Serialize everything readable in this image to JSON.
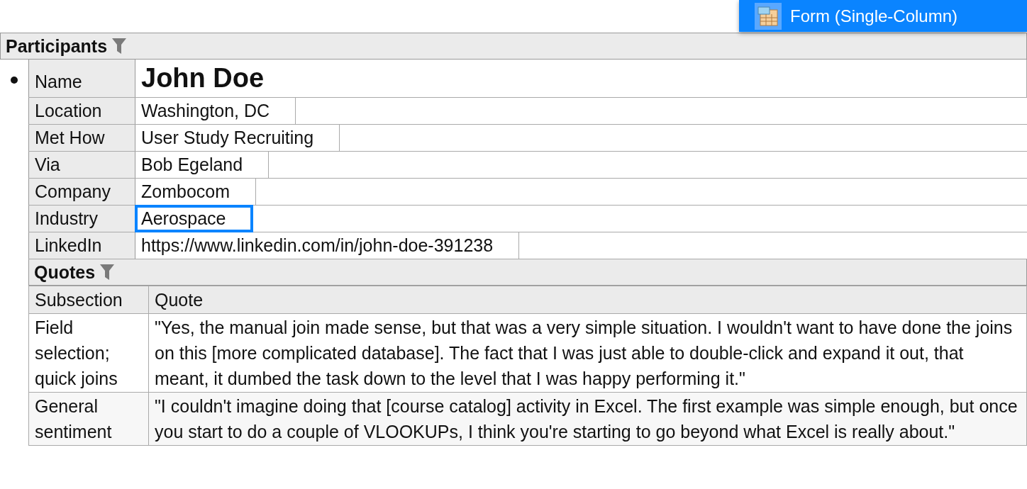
{
  "popup": {
    "label": "Form (Single-Column)"
  },
  "participants": {
    "title": "Participants",
    "records": [
      {
        "fields": [
          {
            "kind": "name",
            "label": "Name",
            "value": "John Doe",
            "selected": false
          },
          {
            "kind": "text",
            "label": "Location",
            "value": "Washington, DC",
            "selected": false
          },
          {
            "kind": "text",
            "label": "Met How",
            "value": "User Study Recruiting",
            "selected": false
          },
          {
            "kind": "text",
            "label": "Via",
            "value": "Bob Egeland",
            "selected": false
          },
          {
            "kind": "text",
            "label": "Company",
            "value": "Zombocom",
            "selected": false
          },
          {
            "kind": "text",
            "label": "Industry",
            "value": "Aerospace",
            "selected": true
          },
          {
            "kind": "text",
            "label": "LinkedIn",
            "value": "https://www.linkedin.com/in/john-doe-391238",
            "selected": false
          }
        ],
        "quotes": {
          "title": "Quotes",
          "columns": [
            "Subsection",
            "Quote"
          ],
          "rows": [
            {
              "subsection": "Field selection; quick joins",
              "quote": "\"Yes, the manual join made sense, but that was a very simple situation. I wouldn't want to have done the joins on this [more complicated database]. The fact that I was just able to double-click and expand it out, that meant, it dumbed the task down to the level that I was happy performing it.\""
            },
            {
              "subsection": "General sentiment",
              "quote": "\"I couldn't imagine doing that [course catalog] activity in Excel. The first example was simple enough, but once you start to do a couple of VLOOKUPs, I think you're starting to go beyond what Excel is really about.\""
            }
          ]
        }
      }
    ]
  }
}
